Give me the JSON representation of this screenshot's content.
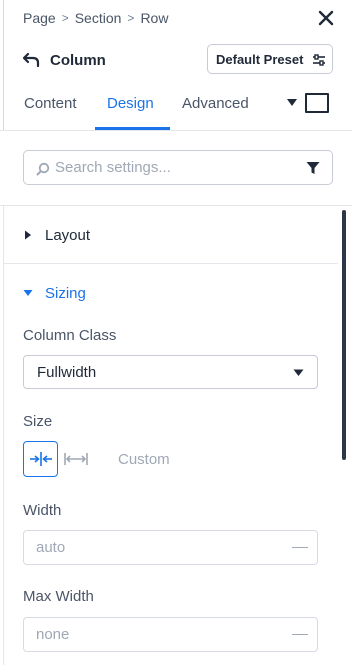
{
  "breadcrumb": {
    "items": [
      "Page",
      "Section",
      "Row"
    ],
    "separator": ">"
  },
  "header": {
    "title": "Column",
    "preset_label": "Default Preset"
  },
  "tabs": [
    {
      "label": "Content",
      "active": false
    },
    {
      "label": "Design",
      "active": true
    },
    {
      "label": "Advanced",
      "active": false
    }
  ],
  "search": {
    "placeholder": "Search settings...",
    "value": ""
  },
  "sections": {
    "layout": {
      "label": "Layout",
      "expanded": false
    },
    "sizing": {
      "label": "Sizing",
      "expanded": true
    }
  },
  "sizing": {
    "column_class_label": "Column Class",
    "column_class_value": "Fullwidth",
    "size_label": "Size",
    "size_options": [
      "shrink-icon",
      "expand-icon"
    ],
    "size_custom_label": "Custom",
    "width_label": "Width",
    "width_placeholder": "auto",
    "max_width_label": "Max Width",
    "max_width_placeholder": "none"
  },
  "colors": {
    "accent": "#1a73e8",
    "text": "#1f2937",
    "muted": "#4a5568",
    "placeholder": "#a0a8b5",
    "border": "#c7ccd4"
  }
}
